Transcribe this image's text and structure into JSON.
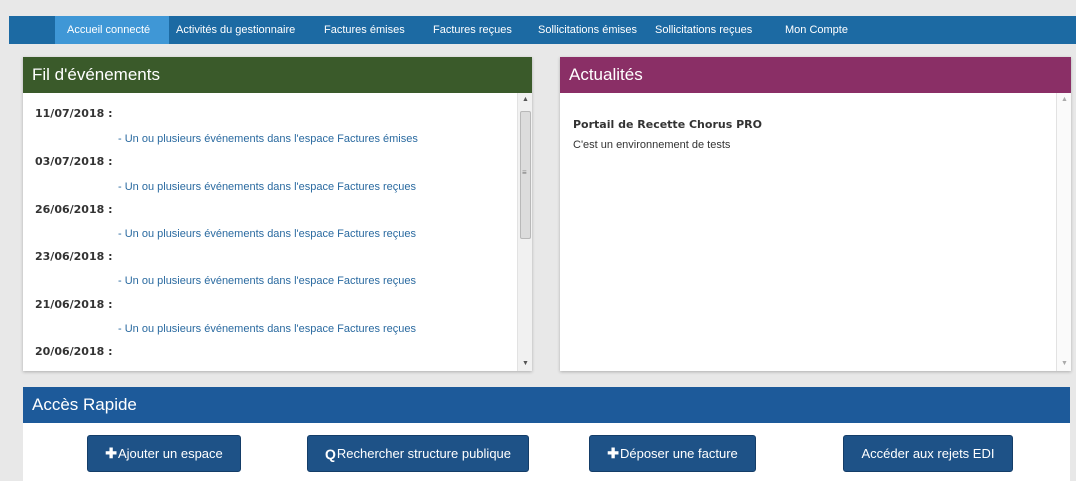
{
  "nav": {
    "tabs": [
      {
        "label": "Accueil connecté",
        "active": true
      },
      {
        "label": "Activités du gestionnaire",
        "active": false
      },
      {
        "label": "Factures émises",
        "active": false
      },
      {
        "label": "Factures reçues",
        "active": false
      },
      {
        "label": "Sollicitations émises",
        "active": false
      },
      {
        "label": "Sollicitations reçues",
        "active": false
      },
      {
        "label": "Mon Compte",
        "active": false
      }
    ]
  },
  "events_panel": {
    "title": "Fil d'événements",
    "items": [
      {
        "date": "11/07/2018 :",
        "link": "- Un ou plusieurs événements dans l'espace Factures émises"
      },
      {
        "date": "03/07/2018 :",
        "link": "- Un ou plusieurs événements dans l'espace Factures reçues"
      },
      {
        "date": "26/06/2018 :",
        "link": "- Un ou plusieurs événements dans l'espace Factures reçues"
      },
      {
        "date": "23/06/2018 :",
        "link": "- Un ou plusieurs événements dans l'espace Factures reçues"
      },
      {
        "date": "21/06/2018 :",
        "link": "- Un ou plusieurs événements dans l'espace Factures reçues"
      },
      {
        "date": "20/06/2018 :",
        "link": ""
      }
    ]
  },
  "news_panel": {
    "title": "Actualités",
    "heading": "Portail de Recette Chorus PRO",
    "text": "C'est un environnement de tests"
  },
  "quick_access": {
    "title": "Accès Rapide",
    "buttons": [
      {
        "icon": "plus-icon",
        "glyph": "✚",
        "label": "Ajouter un espace"
      },
      {
        "icon": "search-icon",
        "glyph": "Q",
        "label": "Rechercher structure publique"
      },
      {
        "icon": "plus-icon",
        "glyph": "✚",
        "label": "Déposer une facture"
      },
      {
        "icon": "",
        "glyph": "",
        "label": "Accéder aux rejets EDI"
      }
    ]
  },
  "colors": {
    "nav_bg": "#1c6aa3",
    "nav_active": "#3f97d6",
    "events_header": "#3a5a2a",
    "news_header": "#8a2f66",
    "quick_header": "#1d5a9a",
    "button_bg": "#1e5287",
    "link": "#2a6aa0"
  }
}
